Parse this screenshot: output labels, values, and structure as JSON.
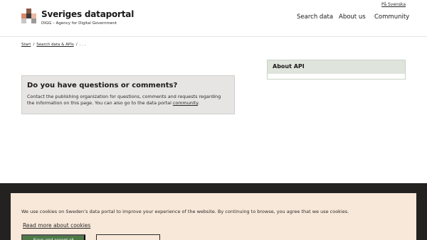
{
  "header": {
    "language_link": "På Svenska",
    "brand_title": "Sveriges dataportal",
    "brand_subtitle": "DIGG – Agency for Digital Government",
    "nav": [
      "Search data",
      "About us",
      "Community"
    ]
  },
  "breadcrumb": {
    "items": [
      "Start",
      "Search data & APIs",
      ". . ."
    ],
    "separator": "/"
  },
  "questions": {
    "title": "Do you have questions or comments?",
    "text": "Contact the publishing organization for questions, comments and requests regarding the information on this page. You can also go to the data portal ",
    "link": "community",
    "end": "."
  },
  "about_panel": {
    "title": "About API"
  },
  "cookie_banner": {
    "text": "We use cookies on Sweden’s data portal to improve your experience of the website. By continuing to browse, you agree that we use cookies.",
    "read_more": "Read more about cookies",
    "accept_button": "Save and accept all"
  },
  "colors": {
    "accent_green": "#4e7a47",
    "cookie_bg": "#f8e8d9",
    "footer_bg": "#232221",
    "panel_head_bg": "#dfe4dd",
    "question_bg": "#e6e5e3"
  }
}
